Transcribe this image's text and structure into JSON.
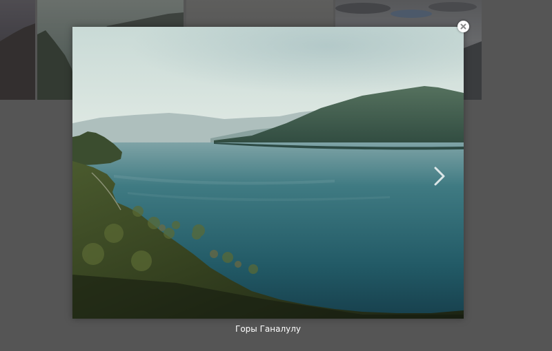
{
  "lightbox": {
    "caption": "Горы Ганалулу",
    "close_icon": "close-icon",
    "next_icon": "chevron-right-icon"
  },
  "colors": {
    "backdrop": "#6a6a6a",
    "caption_text": "#ffffff",
    "water": "#1f5a66",
    "sky": "#dfe8e4"
  }
}
